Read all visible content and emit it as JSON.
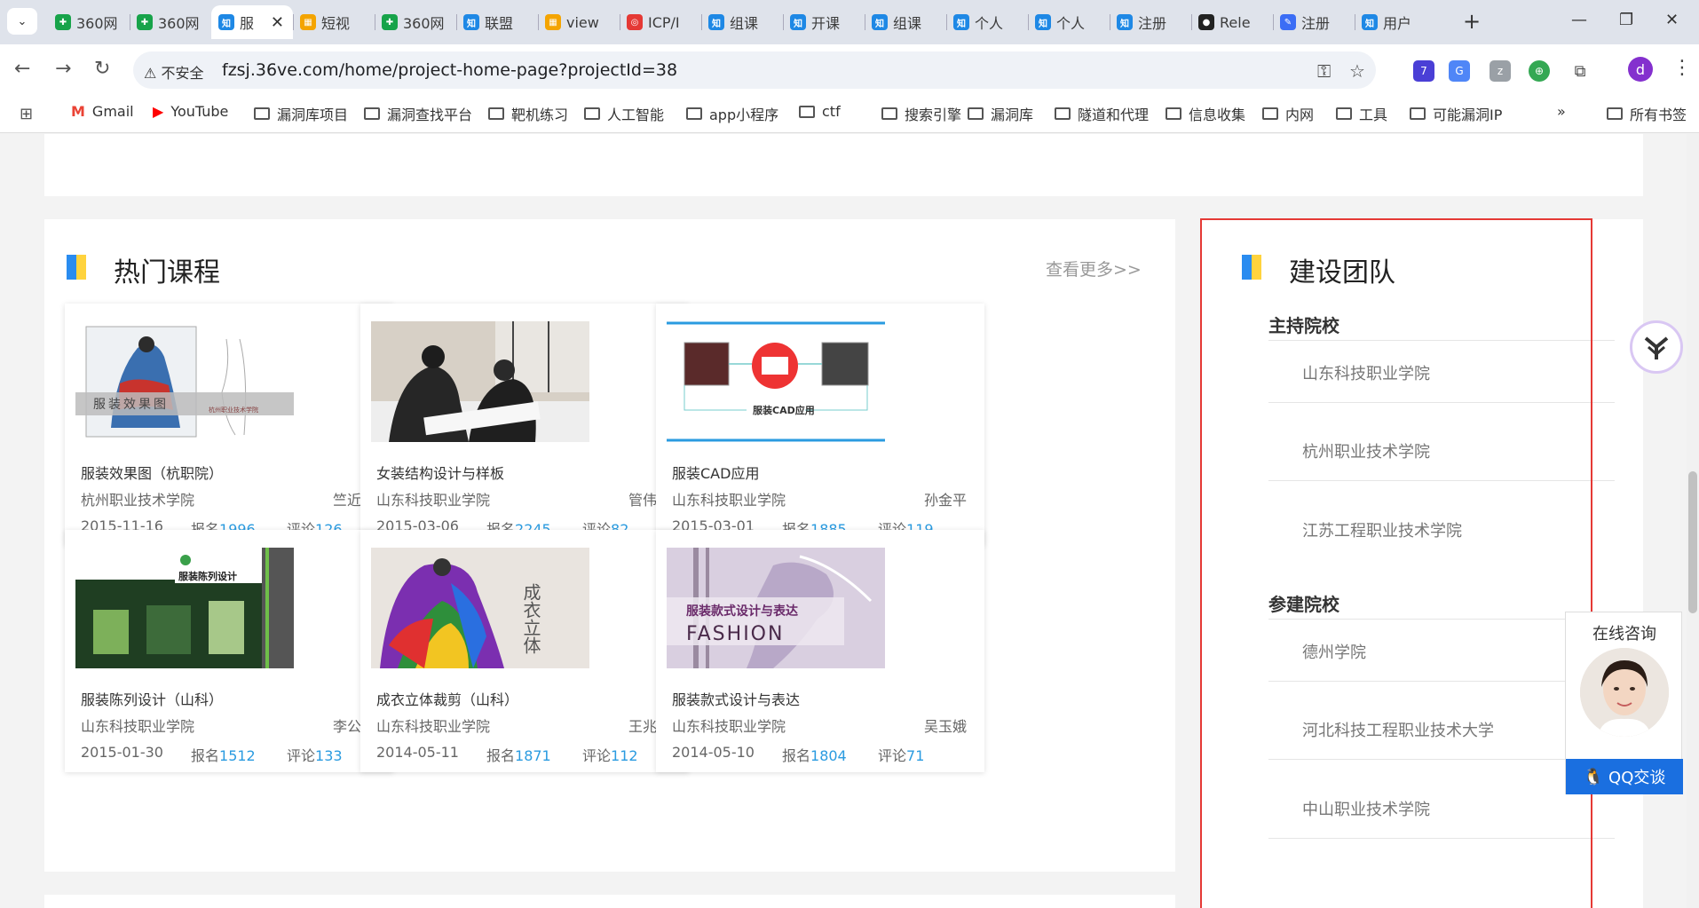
{
  "browser": {
    "tabs": [
      {
        "label": "360网",
        "fav_color": "#17a34a",
        "fav_text": "✚"
      },
      {
        "label": "360网",
        "fav_color": "#17a34a",
        "fav_text": "✚"
      },
      {
        "label": "服",
        "fav_color": "#1e88e5",
        "fav_text": "知",
        "active": true
      },
      {
        "label": "短视",
        "fav_color": "#f4a400",
        "fav_text": "▦"
      },
      {
        "label": "360网",
        "fav_color": "#17a34a",
        "fav_text": "✚"
      },
      {
        "label": "联盟",
        "fav_color": "#1e88e5",
        "fav_text": "知"
      },
      {
        "label": "view",
        "fav_color": "#f4a400",
        "fav_text": "▦"
      },
      {
        "label": "ICP/I",
        "fav_color": "#e53935",
        "fav_text": "◎"
      },
      {
        "label": "组课",
        "fav_color": "#1e88e5",
        "fav_text": "知"
      },
      {
        "label": "开课",
        "fav_color": "#1e88e5",
        "fav_text": "知"
      },
      {
        "label": "组课",
        "fav_color": "#1e88e5",
        "fav_text": "知"
      },
      {
        "label": "个人",
        "fav_color": "#1e88e5",
        "fav_text": "知"
      },
      {
        "label": "个人",
        "fav_color": "#1e88e5",
        "fav_text": "知"
      },
      {
        "label": "注册",
        "fav_color": "#1e88e5",
        "fav_text": "知"
      },
      {
        "label": "Rele",
        "fav_color": "#222222",
        "fav_text": "●"
      },
      {
        "label": "注册",
        "fav_color": "#3b6df5",
        "fav_text": "✎"
      },
      {
        "label": "用户",
        "fav_color": "#1e88e5",
        "fav_text": "知"
      }
    ],
    "insecure_label": "不安全",
    "url": "fzsj.36ve.com/home/project-home-page?projectId=38",
    "ext_badge": "7",
    "profile_initial": "d",
    "bookmarks": [
      {
        "label": "Gmail",
        "type": "gmail"
      },
      {
        "label": "YouTube",
        "type": "youtube"
      },
      {
        "label": "漏洞库项目",
        "type": "folder"
      },
      {
        "label": "漏洞查找平台",
        "type": "folder"
      },
      {
        "label": "靶机练习",
        "type": "folder"
      },
      {
        "label": "人工智能",
        "type": "folder"
      },
      {
        "label": "app小程序",
        "type": "folder"
      },
      {
        "label": "ctf",
        "type": "folder"
      },
      {
        "label": "搜索引擎",
        "type": "folder"
      },
      {
        "label": "漏洞库",
        "type": "folder"
      },
      {
        "label": "隧道和代理",
        "type": "folder"
      },
      {
        "label": "信息收集",
        "type": "folder"
      },
      {
        "label": "内网",
        "type": "folder"
      },
      {
        "label": "工具",
        "type": "folder"
      },
      {
        "label": "可能漏洞IP",
        "type": "folder"
      }
    ],
    "all_bookmarks": "所有书签"
  },
  "hot_courses": {
    "title": "热门课程",
    "more": "查看更多>>",
    "enroll_label": "报名",
    "comment_label": "评论",
    "items": [
      {
        "title": "服装效果图（杭职院）",
        "school": "杭州职业技术学院",
        "teacher": "竺近珠",
        "date": "2015-11-16",
        "enroll": "1996",
        "comments": "126",
        "thumb_text": "服装效果图",
        "thumb_sub": "杭州职业技术学院"
      },
      {
        "title": "女装结构设计与样板",
        "school": "山东科技职业学院",
        "teacher": "管伟丽",
        "date": "2015-03-06",
        "enroll": "2245",
        "comments": "82"
      },
      {
        "title": "服装CAD应用",
        "school": "山东科技职业学院",
        "teacher": "孙金平",
        "date": "2015-03-01",
        "enroll": "1885",
        "comments": "119",
        "thumb_text": "服装CAD应用"
      },
      {
        "title": "服装陈列设计（山科）",
        "school": "山东科技职业学院",
        "teacher": "李公科",
        "date": "2015-01-30",
        "enroll": "1512",
        "comments": "133",
        "thumb_text": "服装陈列设计"
      },
      {
        "title": "成衣立体裁剪（山科）",
        "school": "山东科技职业学院",
        "teacher": "王兆红",
        "date": "2014-05-11",
        "enroll": "1871",
        "comments": "112",
        "thumb_text": "成衣立体裁剪"
      },
      {
        "title": "服装款式设计与表达",
        "school": "山东科技职业学院",
        "teacher": "吴玉娥",
        "date": "2014-05-10",
        "enroll": "1804",
        "comments": "71",
        "thumb_text": "服装款式设计与表达",
        "thumb_sub": "FASHION"
      }
    ]
  },
  "team": {
    "title": "建设团队",
    "host_label": "主持院校",
    "host_schools": [
      "山东科技职业学院",
      "杭州职业技术学院",
      "江苏工程职业技术学院"
    ],
    "participant_label": "参建院校",
    "participant_schools": [
      "德州学院",
      "河北科技工程职业技术大学",
      "中山职业技术学院"
    ]
  },
  "consult": {
    "title": "在线咨询",
    "button": "QQ交谈"
  },
  "colors": {
    "accent_blue": "#2a8cf0",
    "accent_yellow": "#ffd33d",
    "number_blue": "#2a9be0",
    "highlight_red": "#e53935",
    "qq_blue": "#1a6fe0"
  }
}
